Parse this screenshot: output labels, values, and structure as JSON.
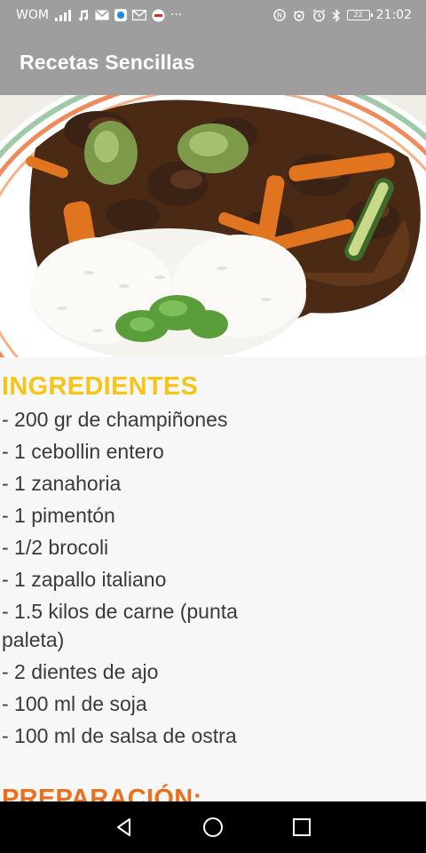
{
  "status_bar": {
    "carrier": "WOM",
    "time": "21:02",
    "battery": "22",
    "overflow": "···"
  },
  "app_bar": {
    "title": "Recetas Sencillas"
  },
  "hero": {
    "icon": "recipe-photo"
  },
  "ingredients": {
    "heading": "INGREDIENTES",
    "items": [
      "- 200 gr de champiñones",
      "- 1 cebollin entero",
      "- 1 zanahoria",
      "- 1 pimentón",
      "- 1/2 brocoli",
      "- 1 zapallo italiano",
      "- 1.5 kilos de carne (punta paleta)",
      "- 2 dientes de ajo",
      "- 100 ml de soja",
      "- 100 ml de salsa de ostra"
    ]
  },
  "preparation": {
    "heading": "PREPARACIÓN:"
  },
  "colors": {
    "bar": "#9e9e9e",
    "heading_ingredients": "#f5c518",
    "heading_preparation": "#e8711f"
  }
}
